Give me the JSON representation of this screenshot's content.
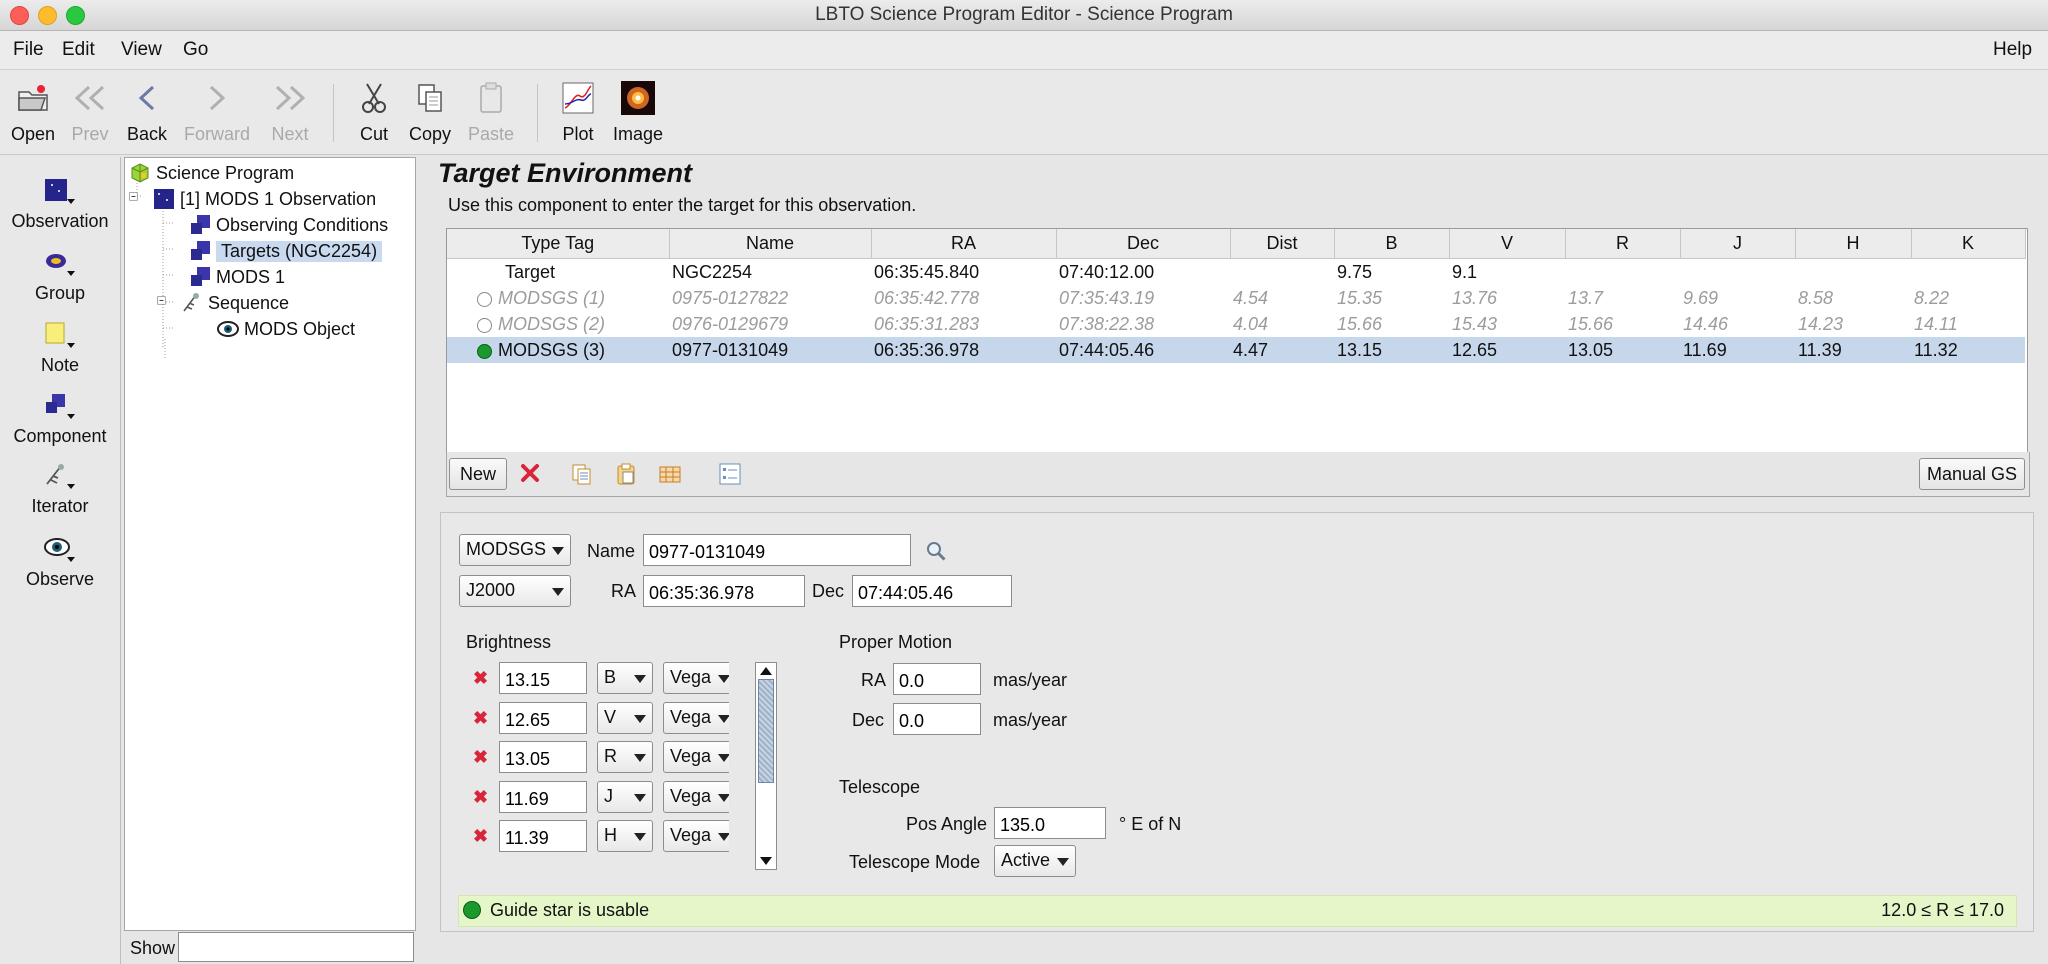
{
  "window": {
    "title": "LBTO Science Program Editor - Science Program"
  },
  "menubar": {
    "file": "File",
    "edit": "Edit",
    "view": "View",
    "go": "Go",
    "help": "Help"
  },
  "toolbar": {
    "open": "Open",
    "prev": "Prev",
    "back": "Back",
    "forward": "Forward",
    "next": "Next",
    "cut": "Cut",
    "copy": "Copy",
    "paste": "Paste",
    "plot": "Plot",
    "image": "Image"
  },
  "palette": {
    "observation": "Observation",
    "group": "Group",
    "note": "Note",
    "component": "Component",
    "iterator": "Iterator",
    "observe": "Observe"
  },
  "tree": {
    "root": "Science Program",
    "observation": "[1] MODS 1 Observation",
    "conditions": "Observing Conditions",
    "targets": "Targets (NGC2254)",
    "mods": "MODS 1",
    "sequence": "Sequence",
    "mods_object": "MODS Object",
    "show_label": "Show",
    "show_value": ""
  },
  "target_env": {
    "title": "Target Environment",
    "subtitle": "Use this component to enter the target for this observation.",
    "columns": [
      "Type Tag",
      "Name",
      "RA",
      "Dec",
      "Dist",
      "B",
      "V",
      "R",
      "J",
      "H",
      "K"
    ],
    "rows": [
      {
        "type": "Target",
        "name": "NGC2254",
        "ra": "06:35:45.840",
        "dec": "07:40:12.00",
        "dist": "",
        "b": "9.75",
        "v": "9.1",
        "r": "",
        "j": "",
        "h": "",
        "k": ""
      },
      {
        "type": "MODSGS (1)",
        "name": "0975-0127822",
        "ra": "06:35:42.778",
        "dec": "07:35:43.19",
        "dist": "4.54",
        "b": "15.35",
        "v": "13.76",
        "r": "13.7",
        "j": "9.69",
        "h": "8.58",
        "k": "8.22"
      },
      {
        "type": "MODSGS (2)",
        "name": "0976-0129679",
        "ra": "06:35:31.283",
        "dec": "07:38:22.38",
        "dist": "4.04",
        "b": "15.66",
        "v": "15.43",
        "r": "15.66",
        "j": "14.46",
        "h": "14.23",
        "k": "14.11"
      },
      {
        "type": "MODSGS (3)",
        "name": "0977-0131049",
        "ra": "06:35:36.978",
        "dec": "07:44:05.46",
        "dist": "4.47",
        "b": "13.15",
        "v": "12.65",
        "r": "13.05",
        "j": "11.69",
        "h": "11.39",
        "k": "11.32"
      }
    ],
    "new_button": "New",
    "manual_gs_button": "Manual GS"
  },
  "detail": {
    "type_value": "MODSGS",
    "name_label": "Name",
    "name_value": "0977-0131049",
    "epoch_value": "J2000",
    "ra_label": "RA",
    "ra_value": "06:35:36.978",
    "dec_label": "Dec",
    "dec_value": "07:44:05.46",
    "brightness_label": "Brightness",
    "brightness": [
      {
        "value": "13.15",
        "band": "B",
        "system": "Vega"
      },
      {
        "value": "12.65",
        "band": "V",
        "system": "Vega"
      },
      {
        "value": "13.05",
        "band": "R",
        "system": "Vega"
      },
      {
        "value": "11.69",
        "band": "J",
        "system": "Vega"
      },
      {
        "value": "11.39",
        "band": "H",
        "system": "Vega"
      }
    ],
    "proper_motion_label": "Proper Motion",
    "pm_ra_label": "RA",
    "pm_ra_value": "0.0",
    "pm_dec_label": "Dec",
    "pm_dec_value": "0.0",
    "pm_unit": "mas/year",
    "telescope_label": "Telescope",
    "pos_angle_label": "Pos Angle",
    "pos_angle_value": "135.0",
    "pos_angle_unit": "° E of N",
    "telescope_mode_label": "Telescope Mode",
    "telescope_mode_value": "Active"
  },
  "status": {
    "message": "Guide star is usable",
    "range": "12.0 ≤ R ≤ 17.0",
    "color": "#1a9a2c"
  }
}
